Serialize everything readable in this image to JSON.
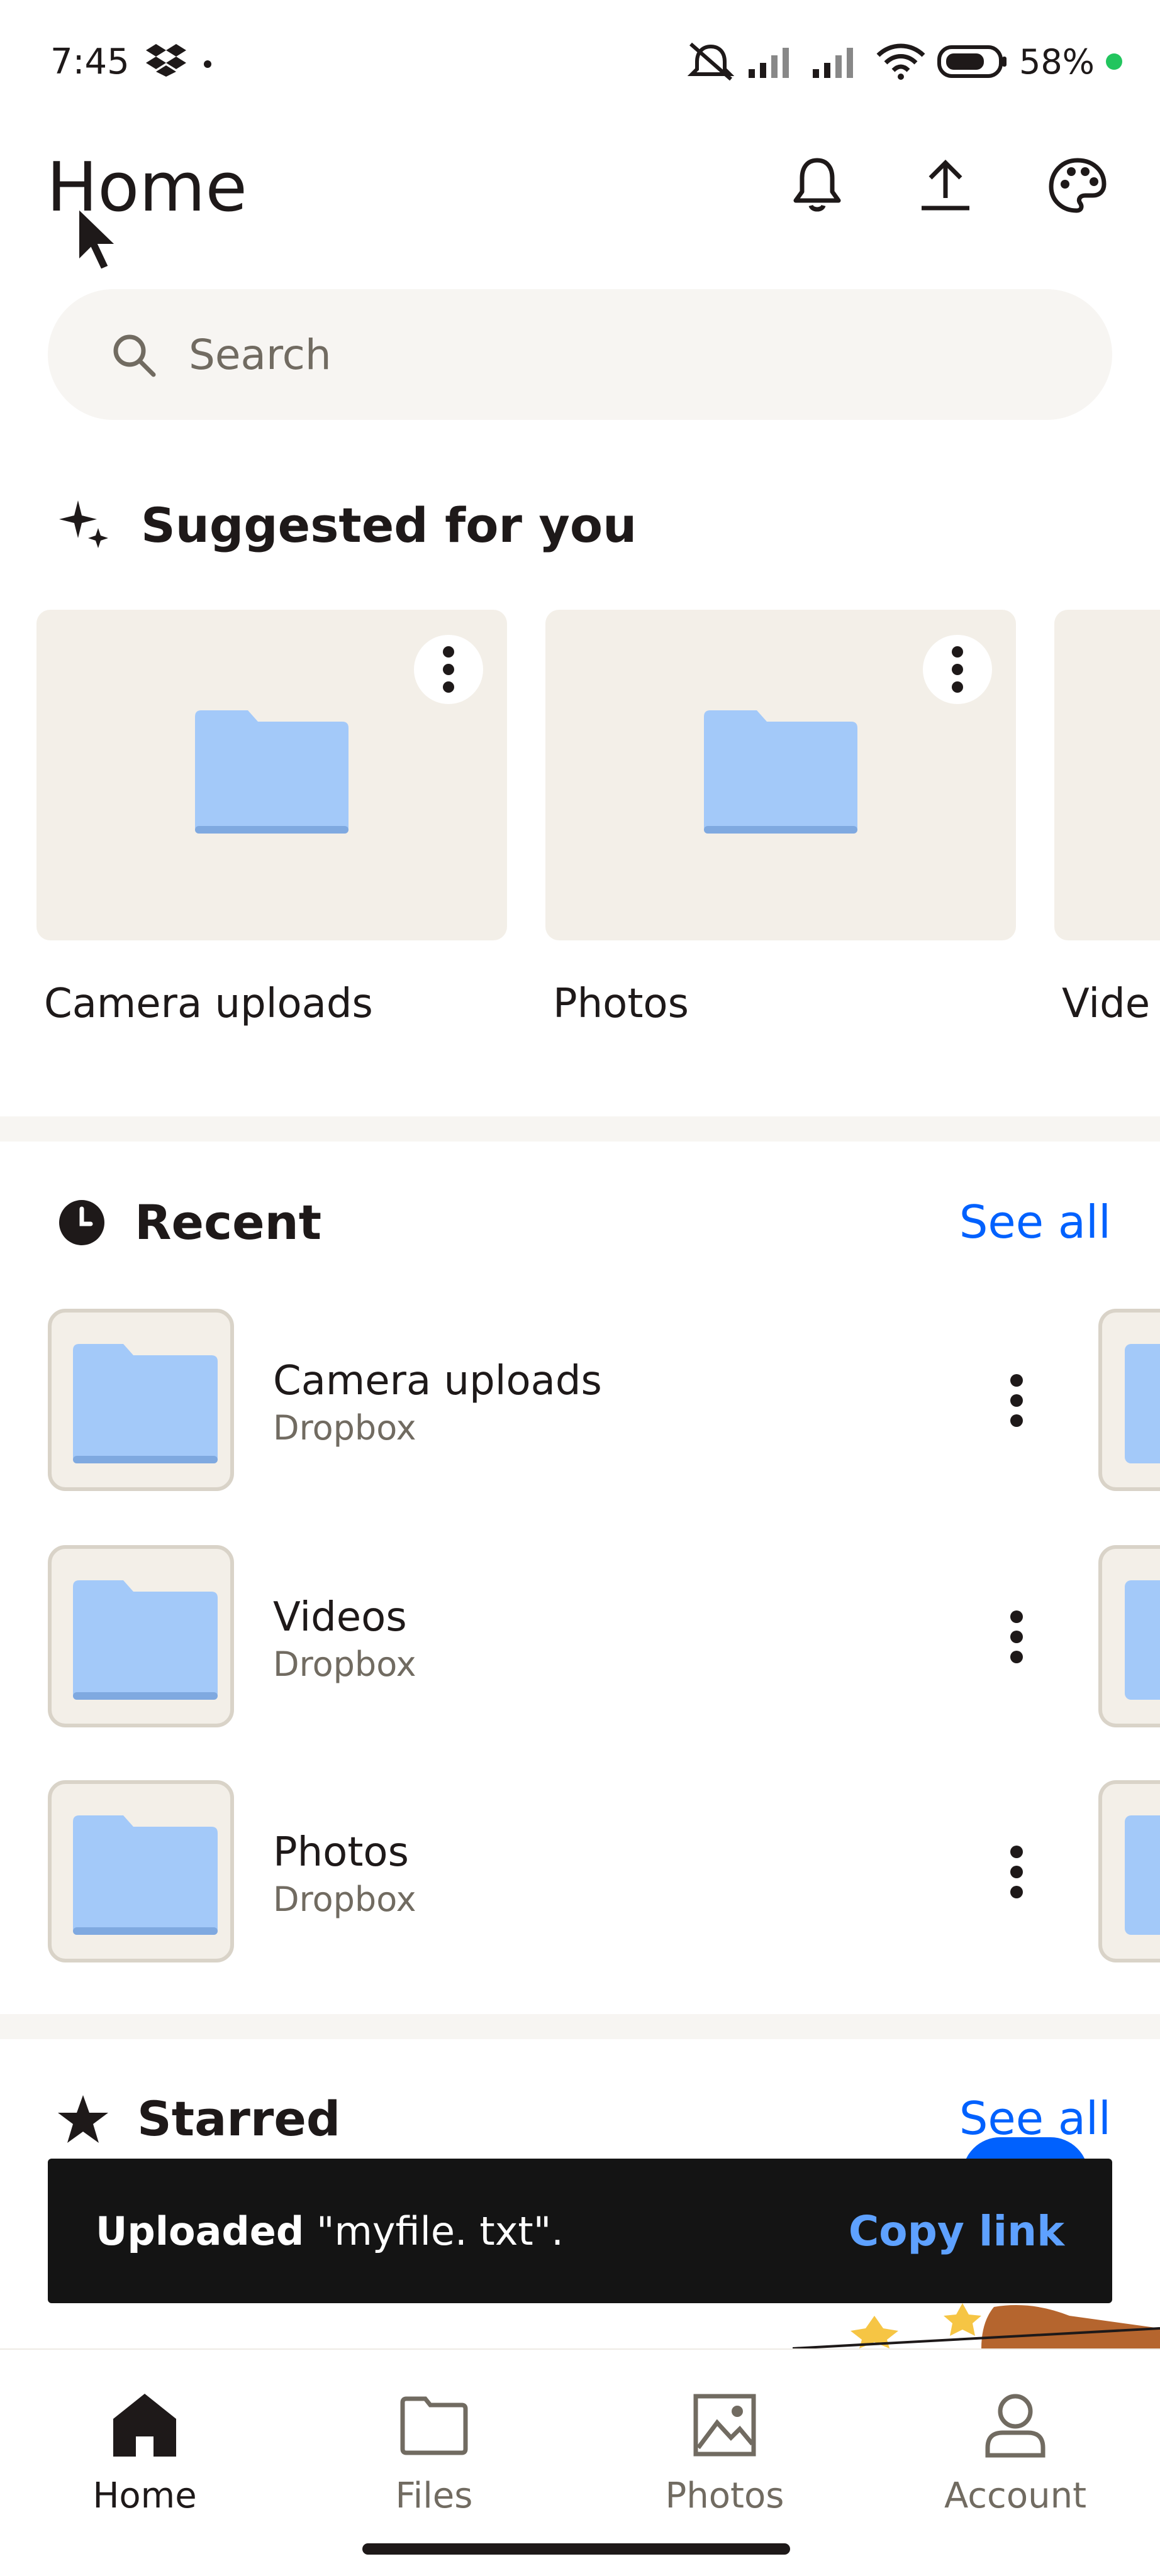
{
  "status_bar": {
    "time": "7:45",
    "battery": "58%",
    "battery_color": "#22c55e"
  },
  "header": {
    "title": "Home"
  },
  "search": {
    "placeholder": "Search"
  },
  "suggested": {
    "title": "Suggested for you",
    "items": [
      {
        "label": "Camera uploads"
      },
      {
        "label": "Photos"
      },
      {
        "label": "Vide"
      }
    ]
  },
  "recent": {
    "title": "Recent",
    "see_all": "See all",
    "items": [
      {
        "title": "Camera uploads",
        "subtitle": "Dropbox"
      },
      {
        "title": "Videos",
        "subtitle": "Dropbox"
      },
      {
        "title": "Photos",
        "subtitle": "Dropbox"
      }
    ]
  },
  "starred": {
    "title": "Starred",
    "see_all": "See all"
  },
  "toast": {
    "prefix": "Uploaded",
    "filename": "\"myfile. txt\".",
    "action": "Copy link"
  },
  "nav": {
    "items": [
      {
        "label": "Home",
        "icon": "home-icon",
        "active": true
      },
      {
        "label": "Files",
        "icon": "folder-icon",
        "active": false
      },
      {
        "label": "Photos",
        "icon": "image-icon",
        "active": false
      },
      {
        "label": "Account",
        "icon": "person-icon",
        "active": false
      }
    ]
  },
  "colors": {
    "accent": "#0061fe",
    "folder": "#a3c9f9",
    "folder_dark": "#7fa9e0",
    "tile": "#f3efe8"
  }
}
